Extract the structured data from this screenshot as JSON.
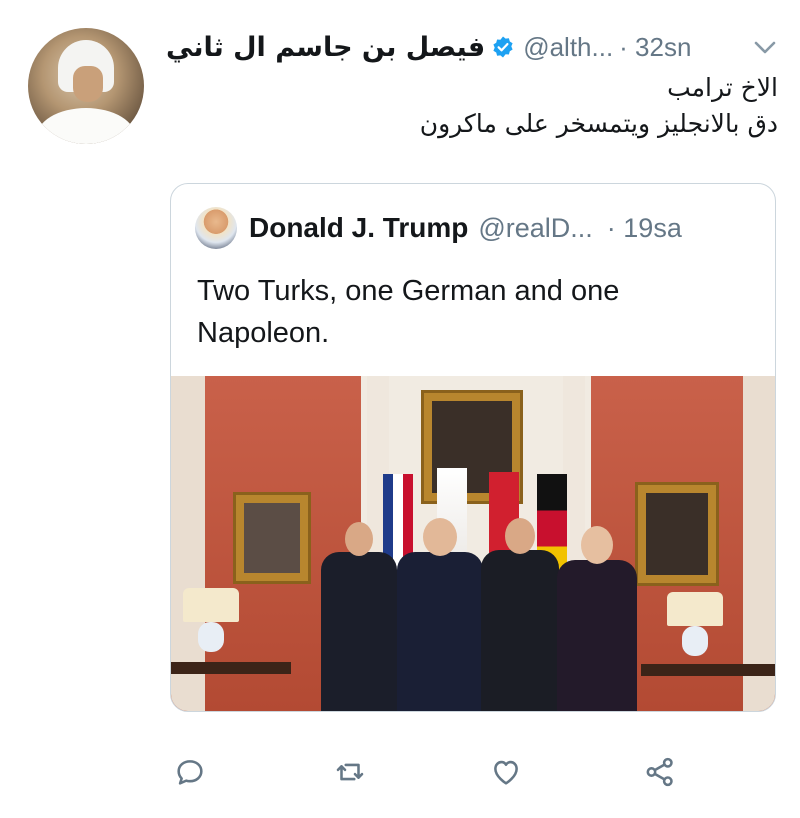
{
  "tweet": {
    "author_name": "فيصل بن جاسم ال ثاني",
    "handle": "@alth...",
    "time": "· 32sn",
    "text_line1": "الاخ ترامب",
    "text_line2": "دق بالانجليز ويتمسخر على ماكرون"
  },
  "quoted": {
    "author_name": "Donald J. Trump",
    "handle": "@realD...",
    "time": "· 19sa",
    "text": "Two Turks, one German and one Napoleon."
  },
  "icons": {
    "verified": "verified-badge-icon",
    "caret": "chevron-down-icon",
    "reply": "reply-icon",
    "retweet": "retweet-icon",
    "like": "heart-icon",
    "share": "share-icon"
  },
  "colors": {
    "accent": "#1da1f2",
    "secondary_text": "#657786",
    "border": "#ccd6dd"
  }
}
